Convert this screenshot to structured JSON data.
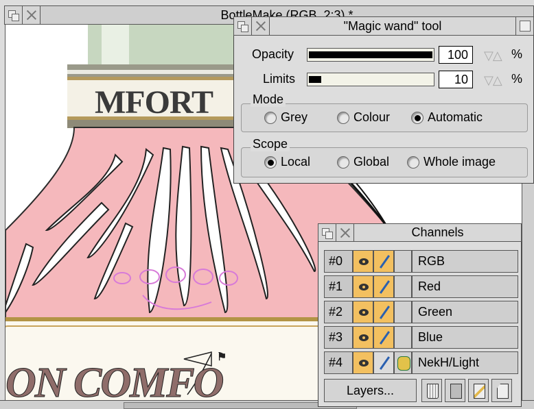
{
  "main_window": {
    "title": "BottleMake (RGB, 2:3) *"
  },
  "wand_tool": {
    "title": "\"Magic wand\" tool",
    "opacity_label": "Opacity",
    "opacity_value": "100",
    "opacity_level": 100,
    "limits_label": "Limits",
    "limits_value": "10",
    "limits_level": 10,
    "arrows": "▽△",
    "percent": "%",
    "mode_label": "Mode",
    "mode_options": [
      "Grey",
      "Colour",
      "Automatic"
    ],
    "mode_selected": "Automatic",
    "scope_label": "Scope",
    "scope_options": [
      "Local",
      "Global",
      "Whole image"
    ],
    "scope_selected": "Local"
  },
  "channels": {
    "title": "Channels",
    "rows": [
      {
        "id": "#0",
        "name": "RGB"
      },
      {
        "id": "#1",
        "name": "Red"
      },
      {
        "id": "#2",
        "name": "Green"
      },
      {
        "id": "#3",
        "name": "Blue"
      },
      {
        "id": "#4",
        "name": "NekH/Light"
      }
    ],
    "layers_button": "Layers..."
  },
  "canvas_text": {
    "label_fragment": "MFORT",
    "label_bottom": "ON COMFO"
  },
  "colors": {
    "bottle_pink": "#f5b8bc",
    "gold": "#c8a35a",
    "selected_tool": "#f3c060"
  }
}
